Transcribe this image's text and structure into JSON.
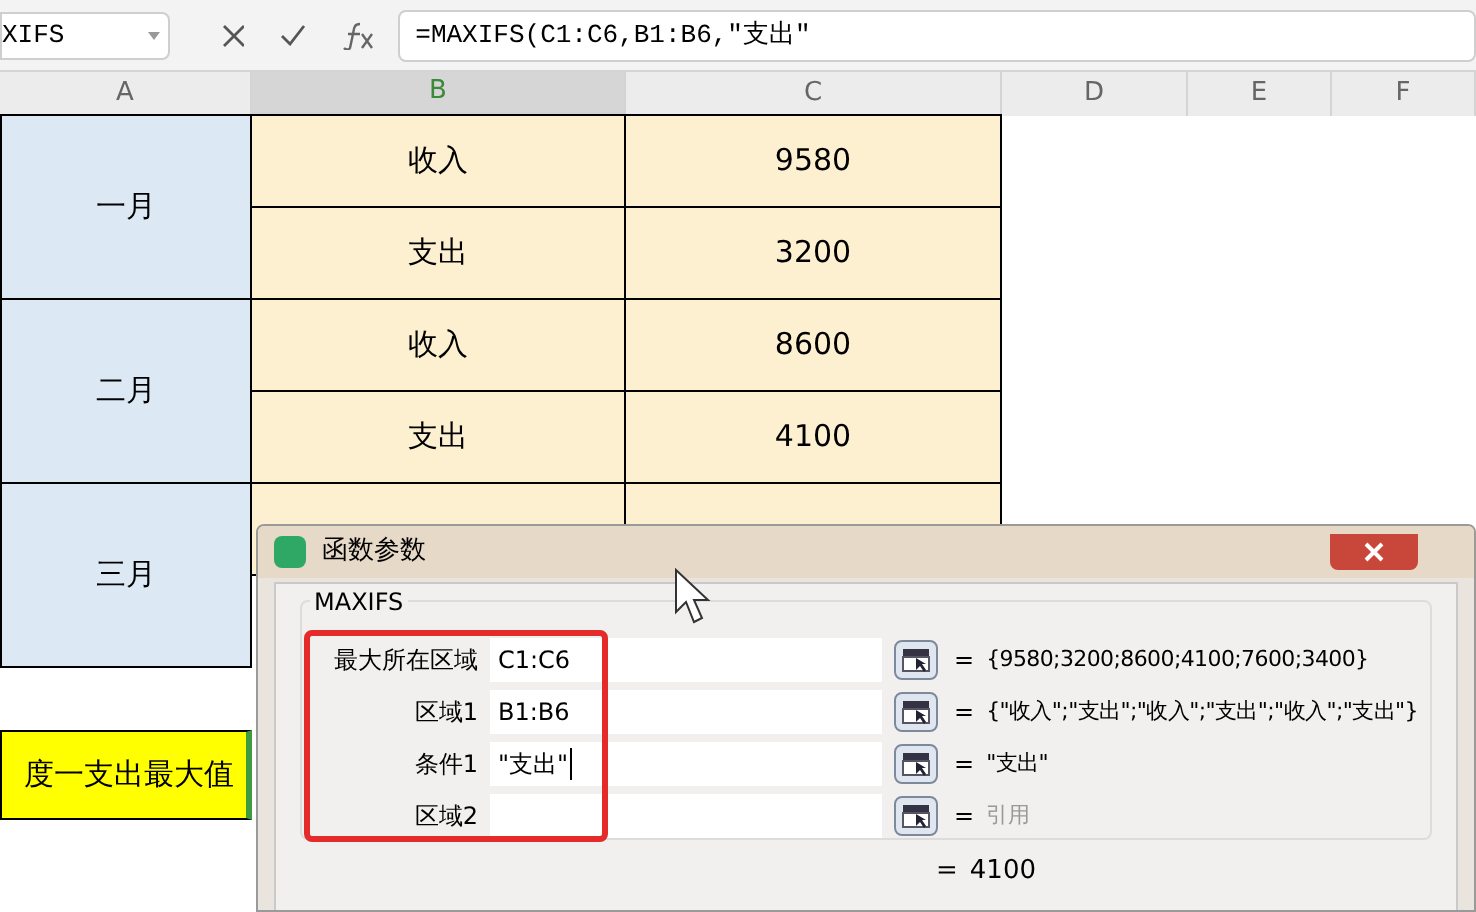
{
  "name_box": "XIFS",
  "formula_bar": {
    "formula": "=MAXIFS(C1:C6,B1:B6,\"支出\""
  },
  "columns": [
    {
      "label": "A",
      "selected": false
    },
    {
      "label": "B",
      "selected": true
    },
    {
      "label": "C",
      "selected": false
    },
    {
      "label": "D",
      "selected": false
    },
    {
      "label": "E",
      "selected": false
    },
    {
      "label": "F",
      "selected": false
    }
  ],
  "months": [
    {
      "label": "一月",
      "items": [
        {
          "type": "收入",
          "amount": "9580"
        },
        {
          "type": "支出",
          "amount": "3200"
        }
      ]
    },
    {
      "label": "二月",
      "items": [
        {
          "type": "收入",
          "amount": "8600"
        },
        {
          "type": "支出",
          "amount": "4100"
        }
      ]
    },
    {
      "label": "三月"
    }
  ],
  "summary_cell": "度一支出最大值",
  "dialog": {
    "title": "函数参数",
    "function_name": "MAXIFS",
    "args": [
      {
        "label": "最大所在区域",
        "value": "C1:C6",
        "result": "{9580;3200;8600;4100;7600;3400}",
        "muted": false,
        "focused": false,
        "sign": "="
      },
      {
        "label": "区域1",
        "value": "B1:B6",
        "result": "{\"收入\";\"支出\";\"收入\";\"支出\";\"收入\";\"支出\"}",
        "muted": false,
        "focused": false,
        "sign": "="
      },
      {
        "label": "条件1",
        "value": "\"支出\"",
        "result": "\"支出\"",
        "muted": false,
        "focused": true,
        "sign": "="
      },
      {
        "label": "区域2",
        "result": "引用",
        "muted": true,
        "focused": false,
        "sign": "="
      }
    ],
    "result": {
      "sign": "=",
      "value": "4100"
    }
  }
}
